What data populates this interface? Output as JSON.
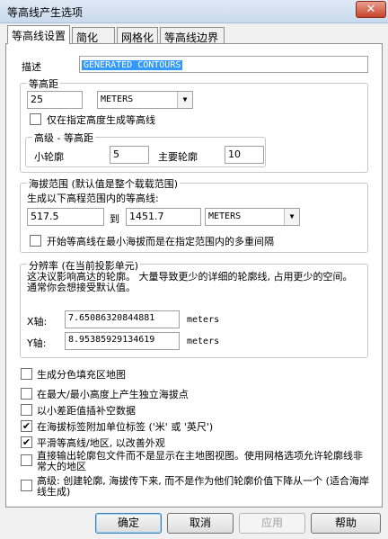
{
  "window": {
    "title": "等高线产生选项",
    "close_label": "✕"
  },
  "tabs": [
    {
      "label": "等高线设置",
      "active": true
    },
    {
      "label": "简化"
    },
    {
      "label": "网格化"
    },
    {
      "label": "等高线边界"
    }
  ],
  "description": {
    "label": "描述",
    "value": "GENERATED CONTOURS"
  },
  "interval": {
    "group_title": "等高距",
    "value": "25",
    "unit": "METERS",
    "only_specified_label": "仅在指定高度生成等高线",
    "only_specified_checked": false,
    "advanced": {
      "group_title": "高级 - 等高距",
      "minor_label": "小轮廓",
      "minor_value": "5",
      "major_label": "主要轮廓",
      "major_value": "10"
    }
  },
  "elevation_range": {
    "group_title": "海拔范围 (默认值是整个载载范围)",
    "intro": "生成以下高程范围内的等高线:",
    "min": "517.5",
    "to_label": "到",
    "max": "1451.7",
    "unit": "METERS",
    "multiple_label": "开始等高线在最小海拔而是在指定范围内的多重间隔",
    "multiple_checked": false
  },
  "resolution": {
    "group_title": "分辨率 (在当前投影单元)",
    "description": "这决议影响高达的轮廓。 大量导致更少的详细的轮廓线, 占用更少的空间。 通常你会想接受默认值。",
    "x_label": "X轴:",
    "x_value": "7.65086320844881",
    "x_unit": "meters",
    "y_label": "Y轴:",
    "y_value": "8.95385929134619",
    "y_unit": "meters"
  },
  "options": [
    {
      "label": "生成分色填充区地图",
      "checked": false
    },
    {
      "label": "在最大/最小高度上产生独立海拔点",
      "checked": false
    },
    {
      "label": "以小差距值插补空数据",
      "checked": false
    },
    {
      "label": "在海拔标签附加单位标签 ('米' 或 '英尺')",
      "checked": true
    },
    {
      "label": "平滑等高线/地区, 以改善外观",
      "checked": true
    },
    {
      "label": "直接输出轮廓包文件而不是显示在主地图视图。使用网格选项允许轮廓线非常大的地区",
      "checked": false
    },
    {
      "label": "高级: 创建轮廓, 海拔传下来, 而不是作为他们轮廓价值下降从一个 (适合海岸线生成)",
      "checked": false
    }
  ],
  "buttons": {
    "ok": "确定",
    "cancel": "取消",
    "apply": "应用",
    "help": "帮助"
  }
}
